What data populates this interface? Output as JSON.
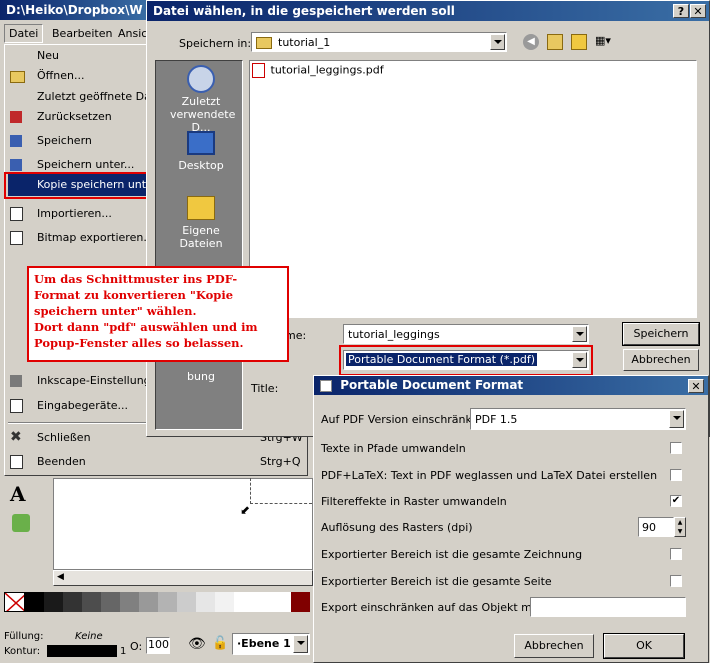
{
  "inkscape": {
    "title": "D:\\Heiko\\Dropbox\\W",
    "menubar": [
      "Datei",
      "Bearbeiten",
      "Ansich"
    ],
    "menu_items": [
      {
        "label": "Neu",
        "shortcut": ""
      },
      {
        "label": "Öffnen...",
        "shortcut": ""
      },
      {
        "label": "Zuletzt geöffnete Date",
        "shortcut": ""
      },
      {
        "label": "Zurücksetzen",
        "shortcut": ""
      },
      {
        "label": "Speichern",
        "shortcut": ""
      },
      {
        "label": "Speichern unter...",
        "shortcut": ""
      },
      {
        "label": "Kopie speichern unter...",
        "shortcut": ""
      },
      {
        "label": "Importieren...",
        "shortcut": ""
      },
      {
        "label": "Bitmap exportieren...",
        "shortcut": ""
      },
      {
        "label": "Inkscape-Einstellunger",
        "shortcut": ""
      },
      {
        "label": "Eingabegeräte...",
        "shortcut": ""
      },
      {
        "label": "Schließen",
        "shortcut": "Strg+W"
      },
      {
        "label": "Beenden",
        "shortcut": "Strg+Q"
      }
    ],
    "status": {
      "fill_label": "Füllung:",
      "fill_value": "Keine",
      "stroke_label": "Kontur:",
      "stroke_width": "1",
      "opacity_label": "O:",
      "opacity_value": "100",
      "layer": "·Ebene 1"
    },
    "palette": [
      "#000000",
      "#1a1a1a",
      "#333333",
      "#4d4d4d",
      "#666666",
      "#808080",
      "#999999",
      "#b3b3b3",
      "#cccccc",
      "#e6e6e6",
      "#f2f2f2",
      "#ffffff",
      "#ffffff",
      "#ffffff",
      "#800000"
    ]
  },
  "save_dialog": {
    "title": "Datei wählen, in die gespeichert werden soll",
    "save_in_label": "Speichern in:",
    "save_in_value": "tutorial_1",
    "places": [
      "Zuletzt verwendete D...",
      "Desktop",
      "Eigene Dateien",
      "bung"
    ],
    "files": [
      "tutorial_leggings.pdf"
    ],
    "filename_label": "me:",
    "filename_value": "tutorial_leggings",
    "filetype_value": "Portable Document Format (*.pdf)",
    "title_label": "Title:",
    "save_button": "Speichern",
    "cancel_button": "Abbrechen"
  },
  "annotation": {
    "text": "Um das Schnittmuster ins PDF-Format zu konvertieren \"Kopie speichern unter\" wählen.\nDort dann \"pdf\" auswählen und im Popup-Fenster alles so belassen."
  },
  "pdf_dialog": {
    "title": "Portable Document Format",
    "version_label": "Auf PDF Version einschränken",
    "version_value": "PDF 1.5",
    "options": [
      {
        "label": "Texte in Pfade umwandeln",
        "checked": false
      },
      {
        "label": "PDF+LaTeX: Text in PDF weglassen und LaTeX Datei erstellen",
        "checked": false
      },
      {
        "label": "Filtereffekte in Raster umwandeln",
        "checked": true
      }
    ],
    "resolution_label": "Auflösung des Rasters (dpi)",
    "resolution_value": "90",
    "options2": [
      {
        "label": "Exportierter Bereich ist die gesamte Zeichnung",
        "checked": false
      },
      {
        "label": "Exportierter Bereich ist die gesamte Seite",
        "checked": false
      }
    ],
    "export_id_label": "Export einschränken auf das Objekt mit ID",
    "export_id_value": "",
    "cancel_button": "Abbrechen",
    "ok_button": "OK"
  },
  "colors": {
    "highlight": "#0a246a",
    "annotation_red": "#e00000"
  }
}
